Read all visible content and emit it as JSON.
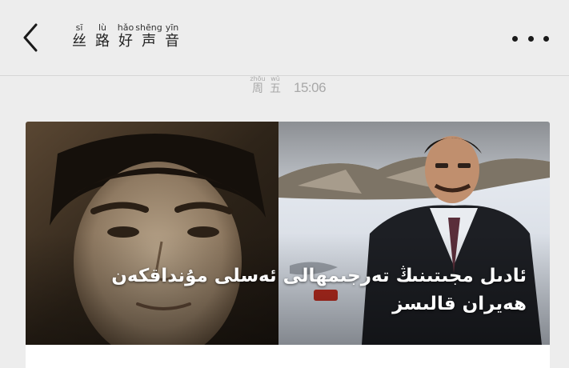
{
  "header": {
    "title_chars": [
      {
        "pinyin": "sī",
        "hanzi": "丝"
      },
      {
        "pinyin": "lù",
        "hanzi": "路"
      },
      {
        "pinyin": "hǎo",
        "hanzi": "好"
      },
      {
        "pinyin": "shēng",
        "hanzi": "声"
      },
      {
        "pinyin": "yīn",
        "hanzi": "音"
      }
    ],
    "back_icon": "chevron-left-icon",
    "more_icon": "more-dots-icon"
  },
  "message": {
    "weekday_chars": [
      {
        "pinyin": "zhōu",
        "hanzi": "周"
      },
      {
        "pinyin": "wǔ",
        "hanzi": "五"
      }
    ],
    "time": "15:06"
  },
  "article_card": {
    "cover_title": "ئادىل مجىتىنىڭ تەرجىمھالى  ئەسلى  مۇنداقكەن ھەيران قالىسز"
  },
  "colors": {
    "background": "#ededed",
    "card": "#ffffff",
    "timestamp": "#a8a8a8"
  }
}
